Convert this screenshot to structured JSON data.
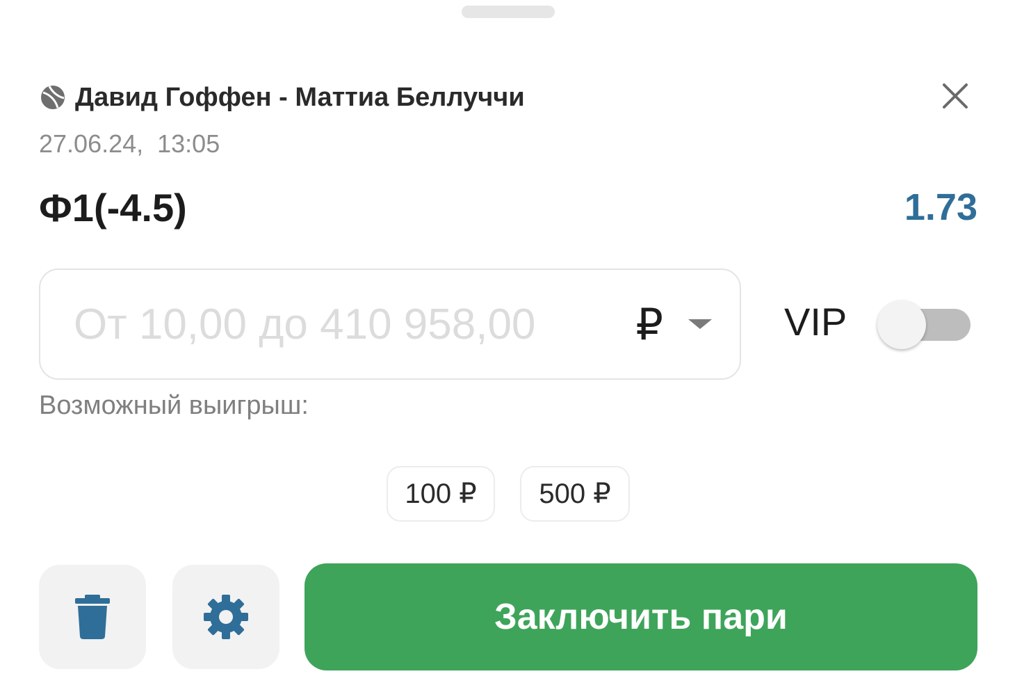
{
  "bet_slip": {
    "match": {
      "sport_icon": "tennis-ball-icon",
      "title": "Давид Гоффен - Маттиа Беллуччи",
      "datetime": "27.06.24,  13:05"
    },
    "market": {
      "name": "Ф1(-4.5)",
      "odds": "1.73"
    },
    "stake": {
      "value": "",
      "placeholder": "От 10,00 до 410 958,00",
      "currency": "₽"
    },
    "vip": {
      "label": "VIP",
      "enabled": false
    },
    "possible_winnings_label": "Возможный выигрыш:",
    "quick_amounts": [
      "100 ₽",
      "500 ₽"
    ],
    "actions": {
      "delete_icon": "trash-icon",
      "settings_icon": "gear-icon",
      "place_bet_label": "Заключить пари"
    }
  },
  "colors": {
    "odds": "#2f6e98",
    "primary_button": "#3ea45a",
    "icon_blue": "#2f6e98",
    "muted_text": "#8c8c8c"
  }
}
